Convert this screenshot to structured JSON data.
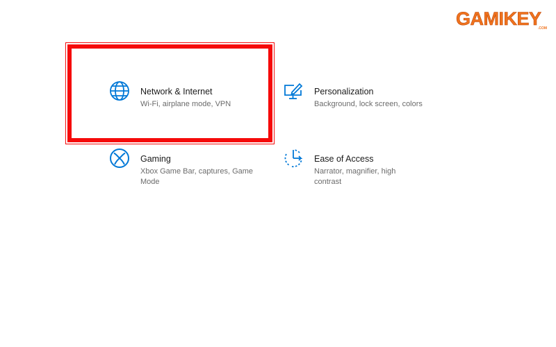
{
  "logo": {
    "text": "GAMIKEY",
    "suffix": ".COM"
  },
  "accent_color": "#0078d7",
  "highlight_color": "#f50a0a",
  "settings_tiles": [
    {
      "icon": "globe-icon",
      "title": "Network & Internet",
      "description": "Wi-Fi, airplane mode, VPN",
      "highlighted": true
    },
    {
      "icon": "personalization-icon",
      "title": "Personalization",
      "description": "Background, lock screen, colors",
      "highlighted": false
    },
    {
      "icon": "xbox-icon",
      "title": "Gaming",
      "description": "Xbox Game Bar, captures, Game Mode",
      "highlighted": false
    },
    {
      "icon": "ease-of-access-icon",
      "title": "Ease of Access",
      "description": "Narrator, magnifier, high contrast",
      "highlighted": false
    }
  ]
}
